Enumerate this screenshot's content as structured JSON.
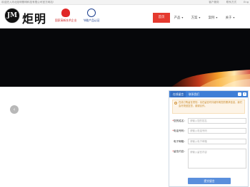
{
  "topbar": {
    "welcome": "欢迎进入河北炬明照明科技有限公司官方网站!",
    "links": [
      "客户服务",
      "联系方式",
      "Eng"
    ]
  },
  "header": {
    "logo_mark": "JM",
    "logo_text": "炬明",
    "badge1_label": "国家高新技术企业",
    "badge2_label": "节能产品认证"
  },
  "nav": {
    "items": [
      {
        "label": "首页",
        "active": true,
        "has_caret": false
      },
      {
        "label": "产品",
        "active": false,
        "has_caret": true
      },
      {
        "label": "方案",
        "active": false,
        "has_caret": true
      },
      {
        "label": "案例",
        "active": false,
        "has_caret": true
      },
      {
        "label": "关于",
        "active": false,
        "has_caret": true
      }
    ]
  },
  "carousel": {
    "prev_glyph": "‹"
  },
  "form_panel": {
    "tabs": [
      "在线留言",
      "联系我们"
    ],
    "notice": "在线订购留言须知：请在留言时详细写明您的需求信息，我们会尽快回复您，谢谢合作。",
    "fields": [
      {
        "label": "您的姓名：",
        "placeholder": "请输入您的姓名",
        "required": true
      },
      {
        "label": "电话号码：",
        "placeholder": "请输入电话号码",
        "required": true
      },
      {
        "label": "电子邮箱：",
        "placeholder": "请输入电子邮箱",
        "required": false
      },
      {
        "label": "留言内容：",
        "placeholder": "请输入留言内容",
        "required": true
      }
    ],
    "submit_label": "提交留言"
  },
  "colors": {
    "accent": "#e53a2f",
    "panel_blue": "#3e7ed6",
    "hero_bg": "#06070a"
  }
}
